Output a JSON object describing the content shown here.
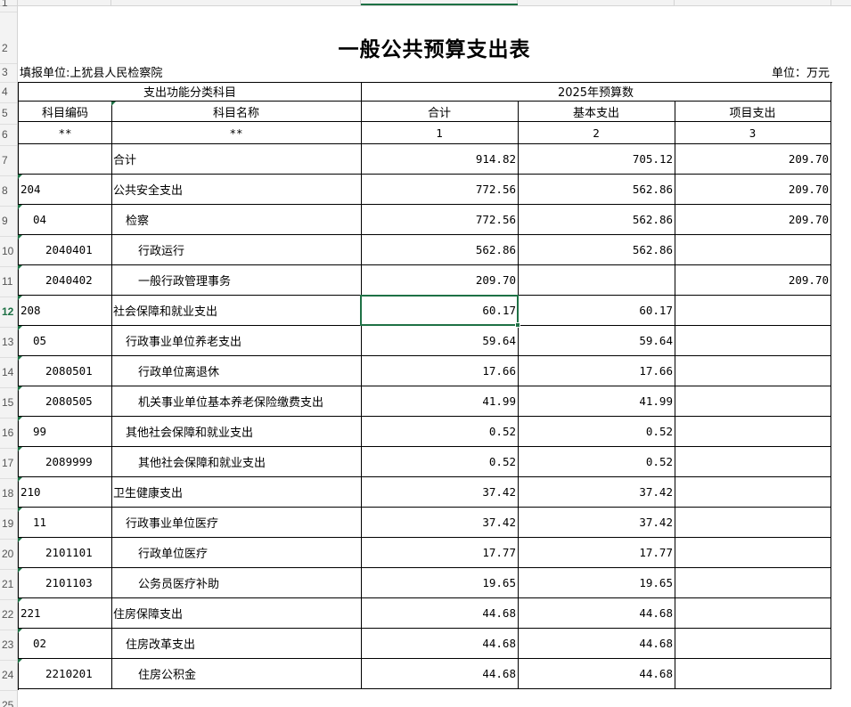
{
  "sheet": {
    "title": "一般公共预算支出表",
    "fill_unit": "填报单位:上犹县人民检察院",
    "unit": "单位：万元",
    "header": {
      "group_left": "支出功能分类科目",
      "group_right": "2025年预算数",
      "code": "科目编码",
      "name": "科目名称",
      "total": "合计",
      "basic": "基本支出",
      "project": "项目支出",
      "idx_code": "**",
      "idx_name": "**",
      "idx_total": "1",
      "idx_basic": "2",
      "idx_project": "3"
    },
    "row_numbers": [
      "1",
      "2",
      "3",
      "4",
      "5",
      "6",
      "7",
      "8",
      "9",
      "10",
      "11",
      "12",
      "13",
      "14",
      "15",
      "16",
      "17",
      "18",
      "19",
      "20",
      "21",
      "22",
      "23",
      "24",
      "25"
    ],
    "active_row": "12",
    "rows": [
      {
        "code": "",
        "name": "合计",
        "total": "914.82",
        "basic": "705.12",
        "project": "209.70",
        "level": 0
      },
      {
        "code": "204",
        "name": "公共安全支出",
        "total": "772.56",
        "basic": "562.86",
        "project": "209.70",
        "level": 0
      },
      {
        "code": "04",
        "name": "检察",
        "total": "772.56",
        "basic": "562.86",
        "project": "209.70",
        "level": 1
      },
      {
        "code": "2040401",
        "name": "行政运行",
        "total": "562.86",
        "basic": "562.86",
        "project": "",
        "level": 2
      },
      {
        "code": "2040402",
        "name": "一般行政管理事务",
        "total": "209.70",
        "basic": "",
        "project": "209.70",
        "level": 2
      },
      {
        "code": "208",
        "name": "社会保障和就业支出",
        "total": "60.17",
        "basic": "60.17",
        "project": "",
        "level": 0
      },
      {
        "code": "05",
        "name": "行政事业单位养老支出",
        "total": "59.64",
        "basic": "59.64",
        "project": "",
        "level": 1
      },
      {
        "code": "2080501",
        "name": "行政单位离退休",
        "total": "17.66",
        "basic": "17.66",
        "project": "",
        "level": 2
      },
      {
        "code": "2080505",
        "name": "机关事业单位基本养老保险缴费支出",
        "total": "41.99",
        "basic": "41.99",
        "project": "",
        "level": 2
      },
      {
        "code": "99",
        "name": "其他社会保障和就业支出",
        "total": "0.52",
        "basic": "0.52",
        "project": "",
        "level": 1
      },
      {
        "code": "2089999",
        "name": "其他社会保障和就业支出",
        "total": "0.52",
        "basic": "0.52",
        "project": "",
        "level": 2
      },
      {
        "code": "210",
        "name": "卫生健康支出",
        "total": "37.42",
        "basic": "37.42",
        "project": "",
        "level": 0
      },
      {
        "code": "11",
        "name": "行政事业单位医疗",
        "total": "37.42",
        "basic": "37.42",
        "project": "",
        "level": 1
      },
      {
        "code": "2101101",
        "name": "行政单位医疗",
        "total": "17.77",
        "basic": "17.77",
        "project": "",
        "level": 2
      },
      {
        "code": "2101103",
        "name": "公务员医疗补助",
        "total": "19.65",
        "basic": "19.65",
        "project": "",
        "level": 2
      },
      {
        "code": "221",
        "name": "住房保障支出",
        "total": "44.68",
        "basic": "44.68",
        "project": "",
        "level": 0
      },
      {
        "code": "02",
        "name": "住房改革支出",
        "total": "44.68",
        "basic": "44.68",
        "project": "",
        "level": 1
      },
      {
        "code": "2210201",
        "name": "住房公积金",
        "total": "44.68",
        "basic": "44.68",
        "project": "",
        "level": 2
      }
    ],
    "selected_cell": {
      "row": "12",
      "column": "合计",
      "value": "60.17"
    },
    "accent": "#1e7145"
  }
}
